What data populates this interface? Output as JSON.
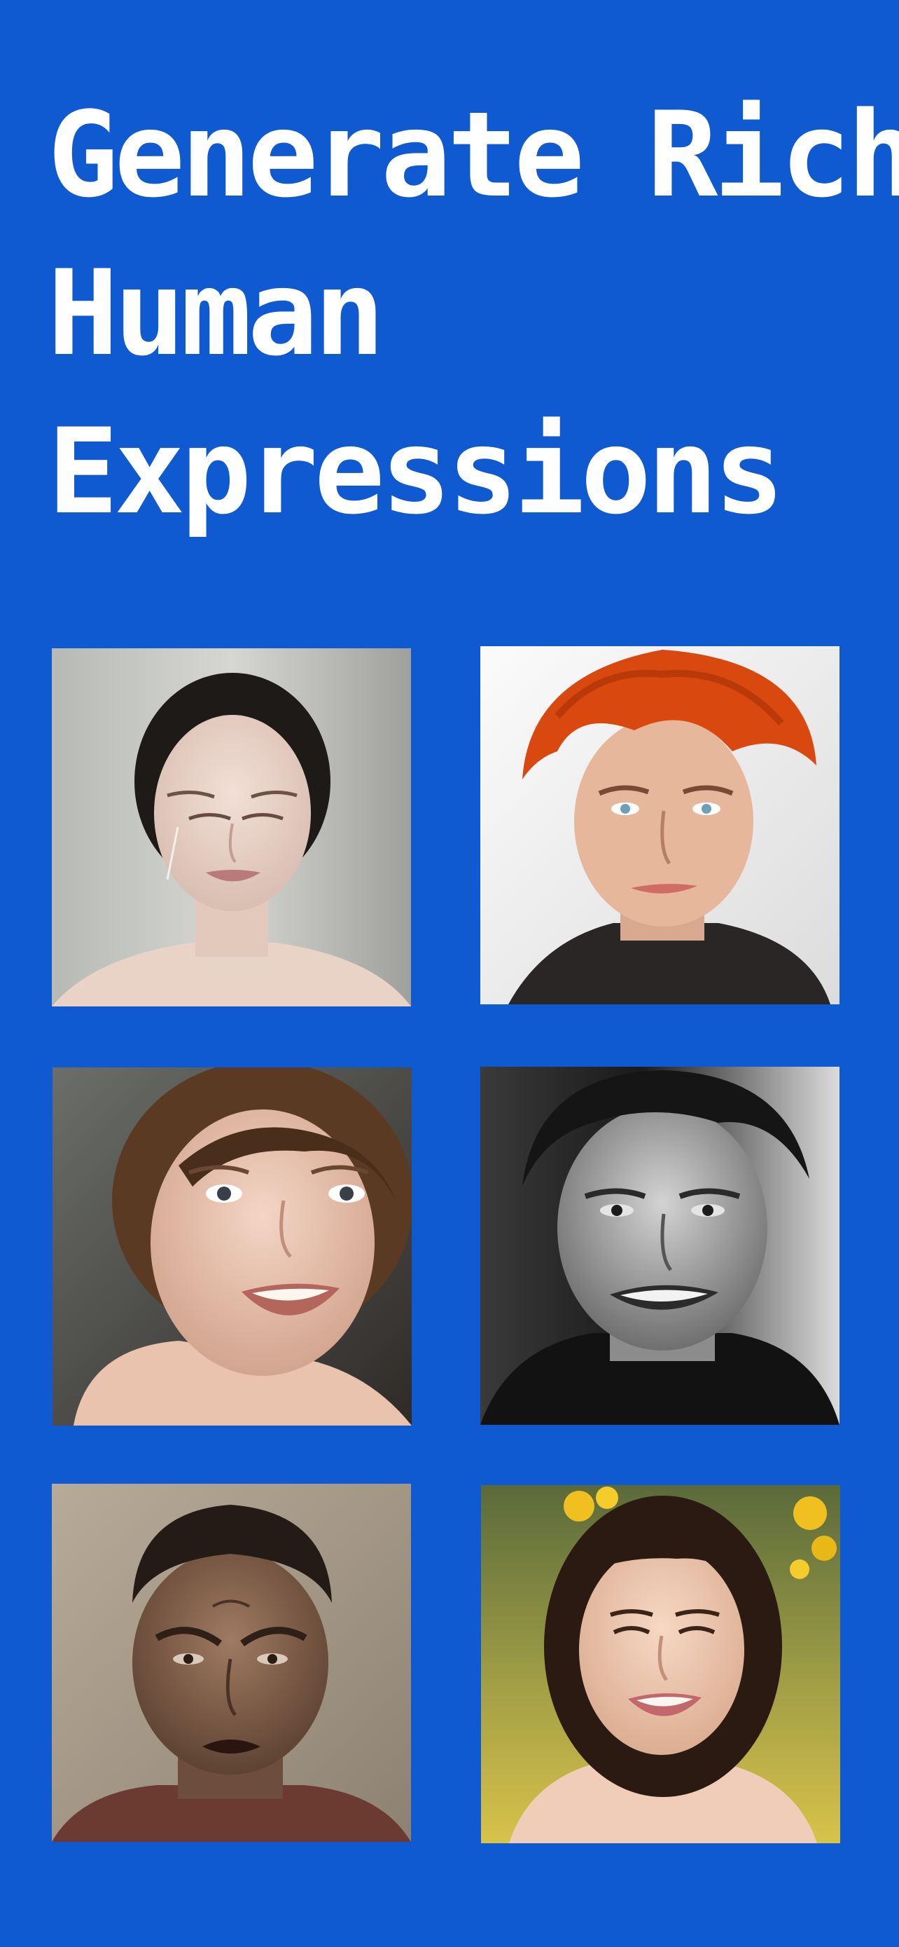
{
  "headline": {
    "line1": "Generate Rich",
    "line2": "Human",
    "line3": "Expressions"
  },
  "colors": {
    "background": "#0F59D1",
    "text": "#FFFFFF"
  },
  "gallery": [
    {
      "expression": "sad",
      "hair": "#1f1a17",
      "palette": "grey"
    },
    {
      "expression": "smirk",
      "hair": "#d9480f",
      "palette": "white"
    },
    {
      "expression": "happy",
      "hair": "#5b3a24",
      "palette": "warm-dark"
    },
    {
      "expression": "smile",
      "hair": "#151515",
      "palette": "monochrome"
    },
    {
      "expression": "angry",
      "hair": "#241b16",
      "palette": "beige"
    },
    {
      "expression": "joyful",
      "hair": "#2b1a12",
      "palette": "golden-outdoor"
    }
  ]
}
